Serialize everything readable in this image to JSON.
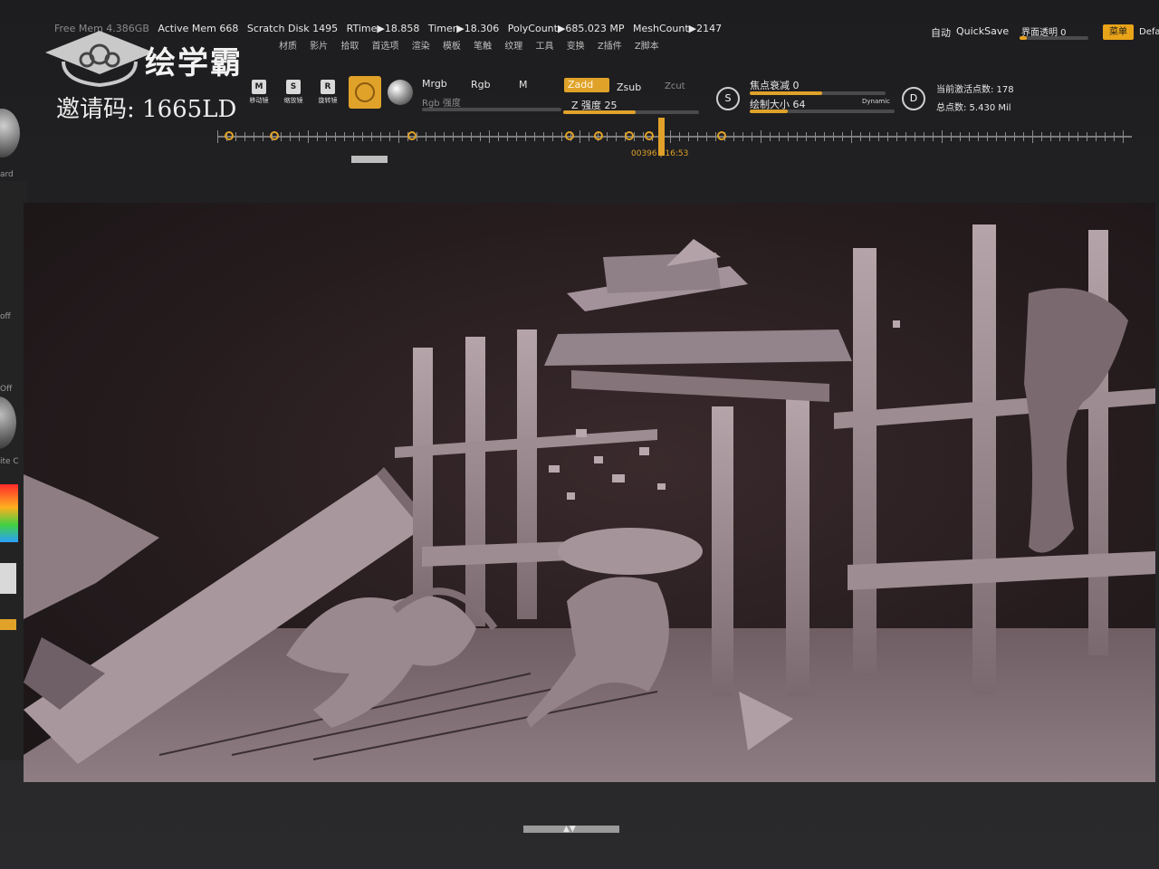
{
  "status_bar": {
    "free_mem": "Free Mem 4.386GB",
    "active_mem": "Active Mem 668",
    "scratch_disk": "Scratch Disk 1495",
    "rtime": "RTime▶18.858",
    "timer": "Timer▶18.306",
    "polycount": "PolyCount▶685.023 MP",
    "meshcount": "MeshCount▶2147",
    "auto": "自动",
    "quicksave": "QuickSave",
    "interface_transparency": "界面透明 0",
    "menu_button": "菜单",
    "default_label": "Defa"
  },
  "menus": [
    "材质",
    "影片",
    "拾取",
    "首选项",
    "渲染",
    "模板",
    "笔触",
    "纹理",
    "工具",
    "变换",
    "Z插件",
    "Z脚本"
  ],
  "watermark": {
    "brand": "绘学霸",
    "invite_code": "邀请码: 1665LD"
  },
  "toolbar": {
    "tools": [
      {
        "key": "M",
        "label": "移动镜"
      },
      {
        "key": "S",
        "label": "缩放镜"
      },
      {
        "key": "R",
        "label": "旋转镜"
      }
    ],
    "mrgb": "Mrgb",
    "rgb": "Rgb",
    "m": "M",
    "rgb_intensity": "Rgb 强度",
    "zadd": "Zadd",
    "zsub": "Zsub",
    "zcut": "Zcut",
    "z_intensity": "Z 强度 25",
    "focal_shift": "焦点衰减 0",
    "draw_size": "绘制大小 64",
    "dynamic": "Dynamic",
    "active_points": "当前激活点数: 178",
    "total_points": "总点数: 5.430 Mil",
    "brush_s_icon": "S",
    "brush_d_icon": "D"
  },
  "timeline": {
    "frame_label": "00396 | 16:53"
  },
  "left_panel": {
    "labels": [
      "ard",
      "off",
      "Off",
      "ite C"
    ]
  },
  "colors": {
    "accent": "#e0a229",
    "background": "#1f1f21",
    "viewport_bg": "#2a1f21",
    "model_clay": "#9a8a8f"
  }
}
